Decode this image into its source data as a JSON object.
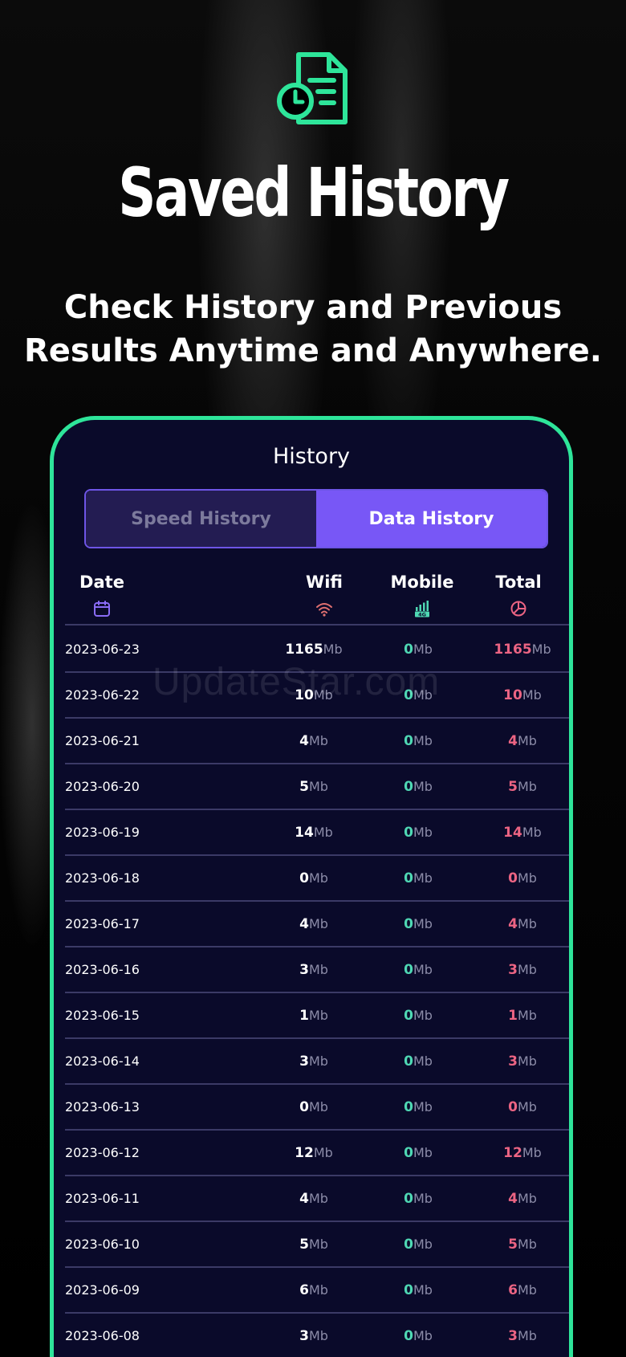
{
  "promo": {
    "headline": "Saved History",
    "subheadline_line1": "Check History and Previous",
    "subheadline_line2": "Results Anytime and Anywhere.",
    "top_icon": "document-clock-icon",
    "accent_color": "#2ee59a"
  },
  "screen": {
    "title": "History",
    "tabs": [
      {
        "label": "Speed History",
        "selected": false
      },
      {
        "label": "Data History",
        "selected": true
      }
    ],
    "columns": {
      "date": {
        "label": "Date",
        "icon": "calendar-icon"
      },
      "wifi": {
        "label": "Wifi",
        "icon": "wifi-icon"
      },
      "mobile": {
        "label": "Mobile",
        "icon": "signal-4g-icon"
      },
      "total": {
        "label": "Total",
        "icon": "pie-chart-icon"
      }
    },
    "unit": "Mb",
    "rows": [
      {
        "date": "2023-06-23",
        "wifi": "1165",
        "mobile": "0",
        "total": "1165"
      },
      {
        "date": "2023-06-22",
        "wifi": "10",
        "mobile": "0",
        "total": "10"
      },
      {
        "date": "2023-06-21",
        "wifi": "4",
        "mobile": "0",
        "total": "4"
      },
      {
        "date": "2023-06-20",
        "wifi": "5",
        "mobile": "0",
        "total": "5"
      },
      {
        "date": "2023-06-19",
        "wifi": "14",
        "mobile": "0",
        "total": "14"
      },
      {
        "date": "2023-06-18",
        "wifi": "0",
        "mobile": "0",
        "total": "0"
      },
      {
        "date": "2023-06-17",
        "wifi": "4",
        "mobile": "0",
        "total": "4"
      },
      {
        "date": "2023-06-16",
        "wifi": "3",
        "mobile": "0",
        "total": "3"
      },
      {
        "date": "2023-06-15",
        "wifi": "1",
        "mobile": "0",
        "total": "1"
      },
      {
        "date": "2023-06-14",
        "wifi": "3",
        "mobile": "0",
        "total": "3"
      },
      {
        "date": "2023-06-13",
        "wifi": "0",
        "mobile": "0",
        "total": "0"
      },
      {
        "date": "2023-06-12",
        "wifi": "12",
        "mobile": "0",
        "total": "12"
      },
      {
        "date": "2023-06-11",
        "wifi": "4",
        "mobile": "0",
        "total": "4"
      },
      {
        "date": "2023-06-10",
        "wifi": "5",
        "mobile": "0",
        "total": "5"
      },
      {
        "date": "2023-06-09",
        "wifi": "6",
        "mobile": "0",
        "total": "6"
      },
      {
        "date": "2023-06-08",
        "wifi": "3",
        "mobile": "0",
        "total": "3"
      }
    ]
  },
  "watermark": "UpdateStar.com"
}
